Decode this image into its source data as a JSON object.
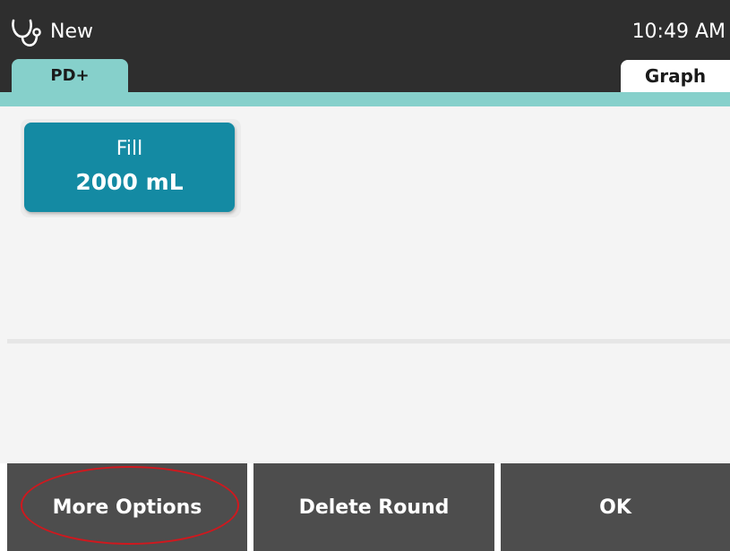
{
  "header": {
    "title": "New",
    "time": "10:49 AM",
    "icon": "stethoscope-icon"
  },
  "tabs": {
    "left_label": "PD+",
    "right_label": "Graph"
  },
  "fill": {
    "label": "Fill",
    "value": "2000 mL"
  },
  "bottom_bar": {
    "more_options_label": "More Options",
    "delete_round_label": "Delete Round",
    "ok_label": "OK"
  },
  "colors": {
    "header_bg": "#2e2e2e",
    "accent_teal": "#86d0cb",
    "fill_button": "#148aa3",
    "bottom_button": "#4d4d4d",
    "highlight": "#d0181e"
  }
}
